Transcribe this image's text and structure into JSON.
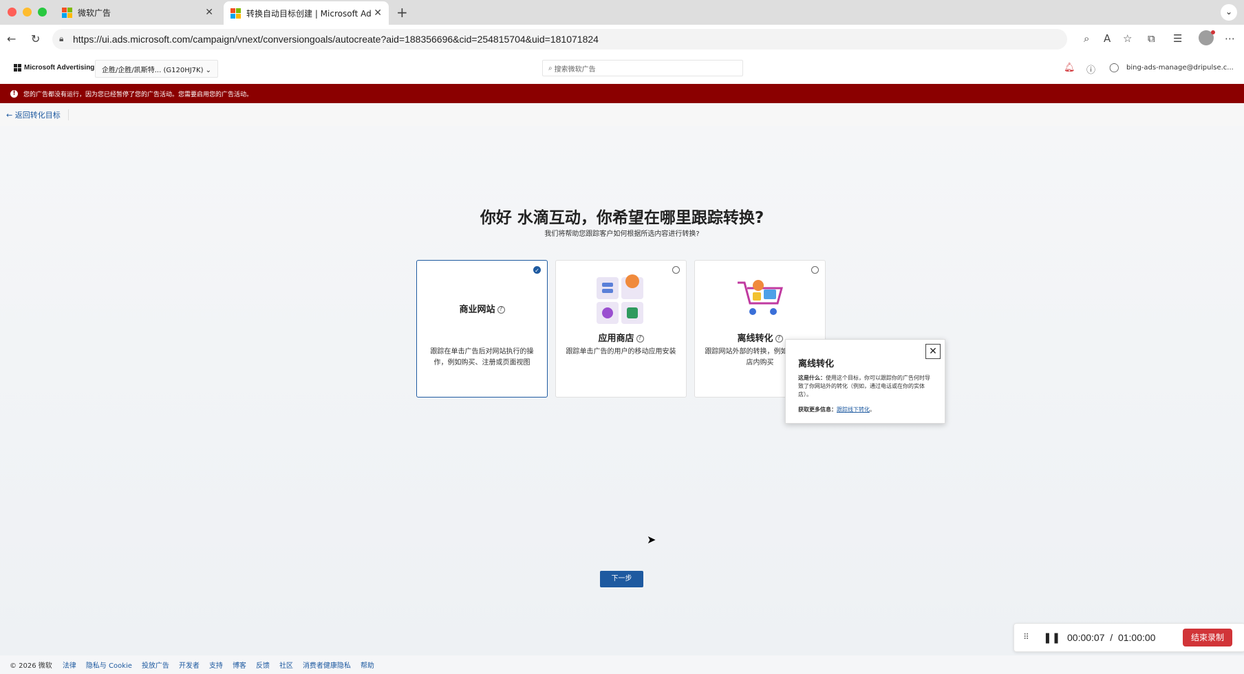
{
  "browser": {
    "tabs": [
      {
        "label": "微软广告",
        "active": false
      },
      {
        "label": "转换自动目标创建 | Microsoft Ad",
        "active": true
      }
    ],
    "url": "https://ui.ads.microsoft.com/campaign/vnext/conversiongoals/autocreate?aid=188356696&cid=254815704&uid=181071824"
  },
  "header": {
    "brand": "Microsoft Advertising",
    "account": "企胜/企胜/凯斯特... (G120HJ7K) ⌄",
    "search_placeholder": "搜索微软广告",
    "user": "bing-ads-manage@dripulse.c..."
  },
  "alert": {
    "text": "您的广告都没有运行，因为您已经暂停了您的广告活动。您需要启用您的广告活动。"
  },
  "back_link": "← 返回转化目标",
  "main": {
    "title": "你好 水滴互动，你希望在哪里跟踪转换?",
    "subtitle": "我们将帮助您跟踪客户如何根据所选内容进行转换?",
    "cards": [
      {
        "title": "商业网站",
        "desc": "跟踪在单击广告后对网站执行的操作，例如购买、注册或页面视图",
        "selected": true
      },
      {
        "title": "应用商店",
        "desc": "跟踪单击广告的用户的移动应用安装",
        "selected": false
      },
      {
        "title": "离线转化",
        "desc": "跟踪网站外部的转换，例如单击进行店内购买",
        "selected": false
      }
    ],
    "next_button": "下一步"
  },
  "popover": {
    "title": "离线转化",
    "body_label": "这是什么：",
    "body": "使用这个目标，你可以跟踪你的广告何时导致了你网站外的转化（例如，通过电话或在你的实体店）。",
    "more_label": "获取更多信息：",
    "more_link": "跟踪线下转化",
    "more_suffix": "。"
  },
  "recorder": {
    "elapsed": "00:00:07",
    "separator": "/",
    "total": "01:00:00",
    "end_button": "结束录制"
  },
  "footer": {
    "copyright": "© 2026 微软",
    "links": [
      "法律",
      "隐私与 Cookie",
      "投放广告",
      "开发者",
      "支持",
      "博客",
      "反馈",
      "社区",
      "消费者健康隐私",
      "帮助"
    ]
  },
  "colors": {
    "alert_bg": "#8b0000",
    "accent": "#1e5aa0",
    "record_end": "#d13438"
  }
}
